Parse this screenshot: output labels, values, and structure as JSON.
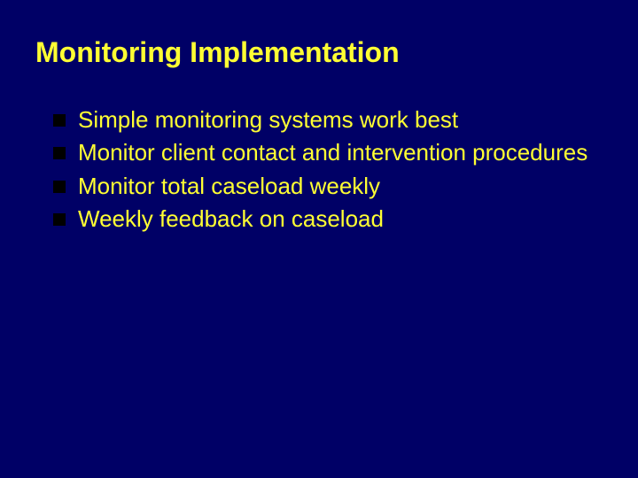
{
  "title": "Monitoring Implementation",
  "bullets": [
    "Simple monitoring systems work best",
    "Monitor client contact and intervention procedures",
    "Monitor total caseload weekly",
    "Weekly feedback on caseload"
  ]
}
